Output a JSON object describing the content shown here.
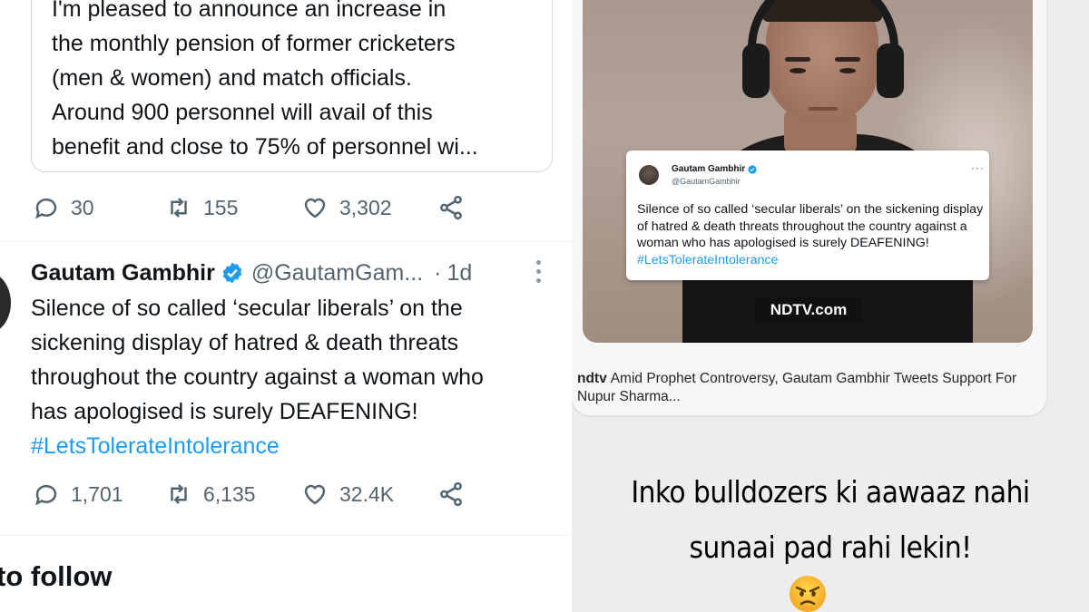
{
  "twitter": {
    "quoted_tweet": {
      "lines": [
        "I'm pleased to announce an increase in",
        "the monthly pension of former cricketers",
        "(men & women) and match officials.",
        "Around 900 personnel will avail of this",
        "benefit and close to 75% of personnel wi..."
      ]
    },
    "quoted_actions": {
      "replies": "30",
      "retweets": "155",
      "likes": "3,302"
    },
    "tweet": {
      "name": "Gautam Gambhir",
      "handle": "@GautamGam...",
      "separator": "·",
      "time": "1d",
      "lines": [
        "Silence of so called ‘secular liberals’ on the",
        "sickening display of hatred & death threats",
        "throughout the country against a woman who",
        "has apologised is surely DEAFENING!"
      ],
      "hashtag": "#LetsTolerateIntolerance",
      "actions": {
        "replies": "1,701",
        "retweets": "6,135",
        "likes": "32.4K"
      }
    },
    "who_to_follow": "to follow",
    "colors": {
      "link": "#1d9bf0",
      "muted": "#536471",
      "text": "#0f1419"
    }
  },
  "story": {
    "embedded_tweet": {
      "name": "Gautam Gambhir",
      "handle": "@GautamGambhir",
      "more": "···",
      "text": "Silence of so called ‘secular liberals’ on the sickening display of hatred & death threats throughout the country against a woman who has apologised is surely DEAFENING!",
      "hashtag": "#LetsTolerateIntolerance"
    },
    "watermark": "NDTV.com",
    "link_source": "ndtv",
    "link_title": "Amid Prophet Controversy, Gautam Gambhir Tweets Support For Nupur Sharma...",
    "caption_line1": "Inko bulldozers ki aawaaz nahi",
    "caption_line2": "sunaai pad rahi lekin!",
    "emoji": "angry-face-emoji"
  }
}
